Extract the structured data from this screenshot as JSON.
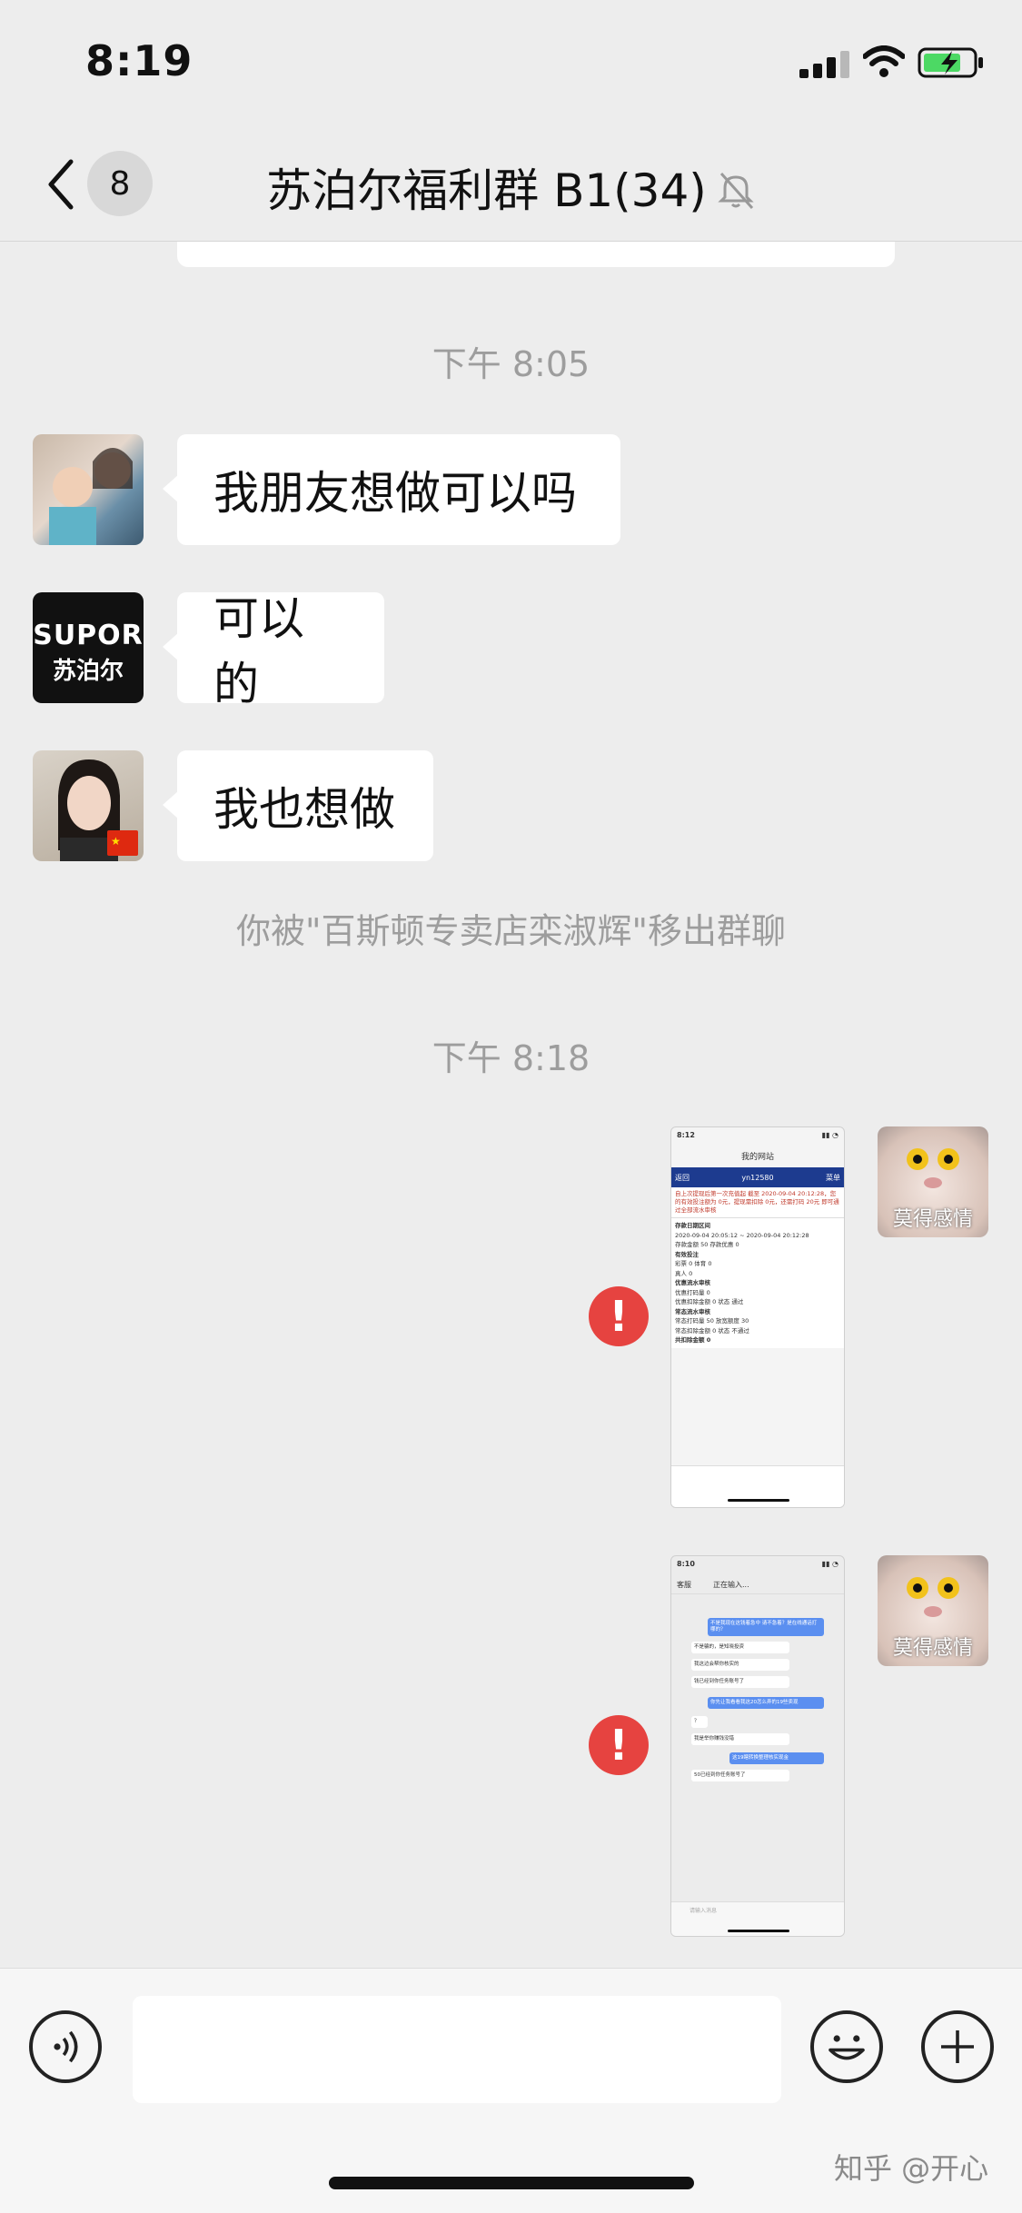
{
  "status": {
    "time": "8:19"
  },
  "header": {
    "back_count": "8",
    "title": "苏泊尔福利群 B1(34)"
  },
  "messages": {
    "time_1": "下午 8:05",
    "msg_1": "我朋友想做可以吗",
    "msg_2": "可以的",
    "msg_3": "我也想做",
    "system_notice": "你被\"百斯顿专卖店栾淑辉\"移出群聊",
    "time_2": "下午 8:18",
    "sticker_caption": "莫得感情",
    "error_mark": "!"
  },
  "avatar_brand": {
    "line1": "SUPOR",
    "line2": "苏泊尔"
  },
  "screenshot_1": {
    "time": "8:12",
    "title": "我的网站",
    "back": "返回",
    "user": "yn12580",
    "menu": "菜单",
    "notice": "自上次提现后第一次充值起 截至 2020-09-04 20:12:28，您的有效投注额为 0元，提现需扣除 0元，还需打码 20元 即可通过全部流水审核",
    "rows": [
      "存款日期区间",
      "2020-09-04 20:05:12 ~ 2020-09-04 20:12:28",
      "存款金额 50    存款优惠 0",
      "有效投注",
      "彩票 0    体育 0",
      "真人 0",
      "优惠流水审核",
      "优惠打码量 0",
      "优惠扣除金额 0    状态 通过",
      "常态流水审核",
      "常态打码量 50    放宽额度 30",
      "常态扣除金额 0    状态 不通过",
      "共扣除金额 0"
    ]
  },
  "screenshot_2": {
    "time": "8:10",
    "back": "客服",
    "title": "正在输入...",
    "chat": [
      "不是我现在这钱着急中 请不急着？是在线通话打哪的？",
      "不是骗的，是知晓投资",
      "我这边会帮你核实的",
      "钱已经到你任务账号了",
      "你先让我看看我这20怎么弄的19些卖现",
      "？",
      "我是举你赚钱没错",
      "这19瞎转换整理核实现金",
      "50已经到你任务账号了"
    ],
    "input_placeholder": "请输入消息"
  },
  "watermark": "知乎 @开心"
}
